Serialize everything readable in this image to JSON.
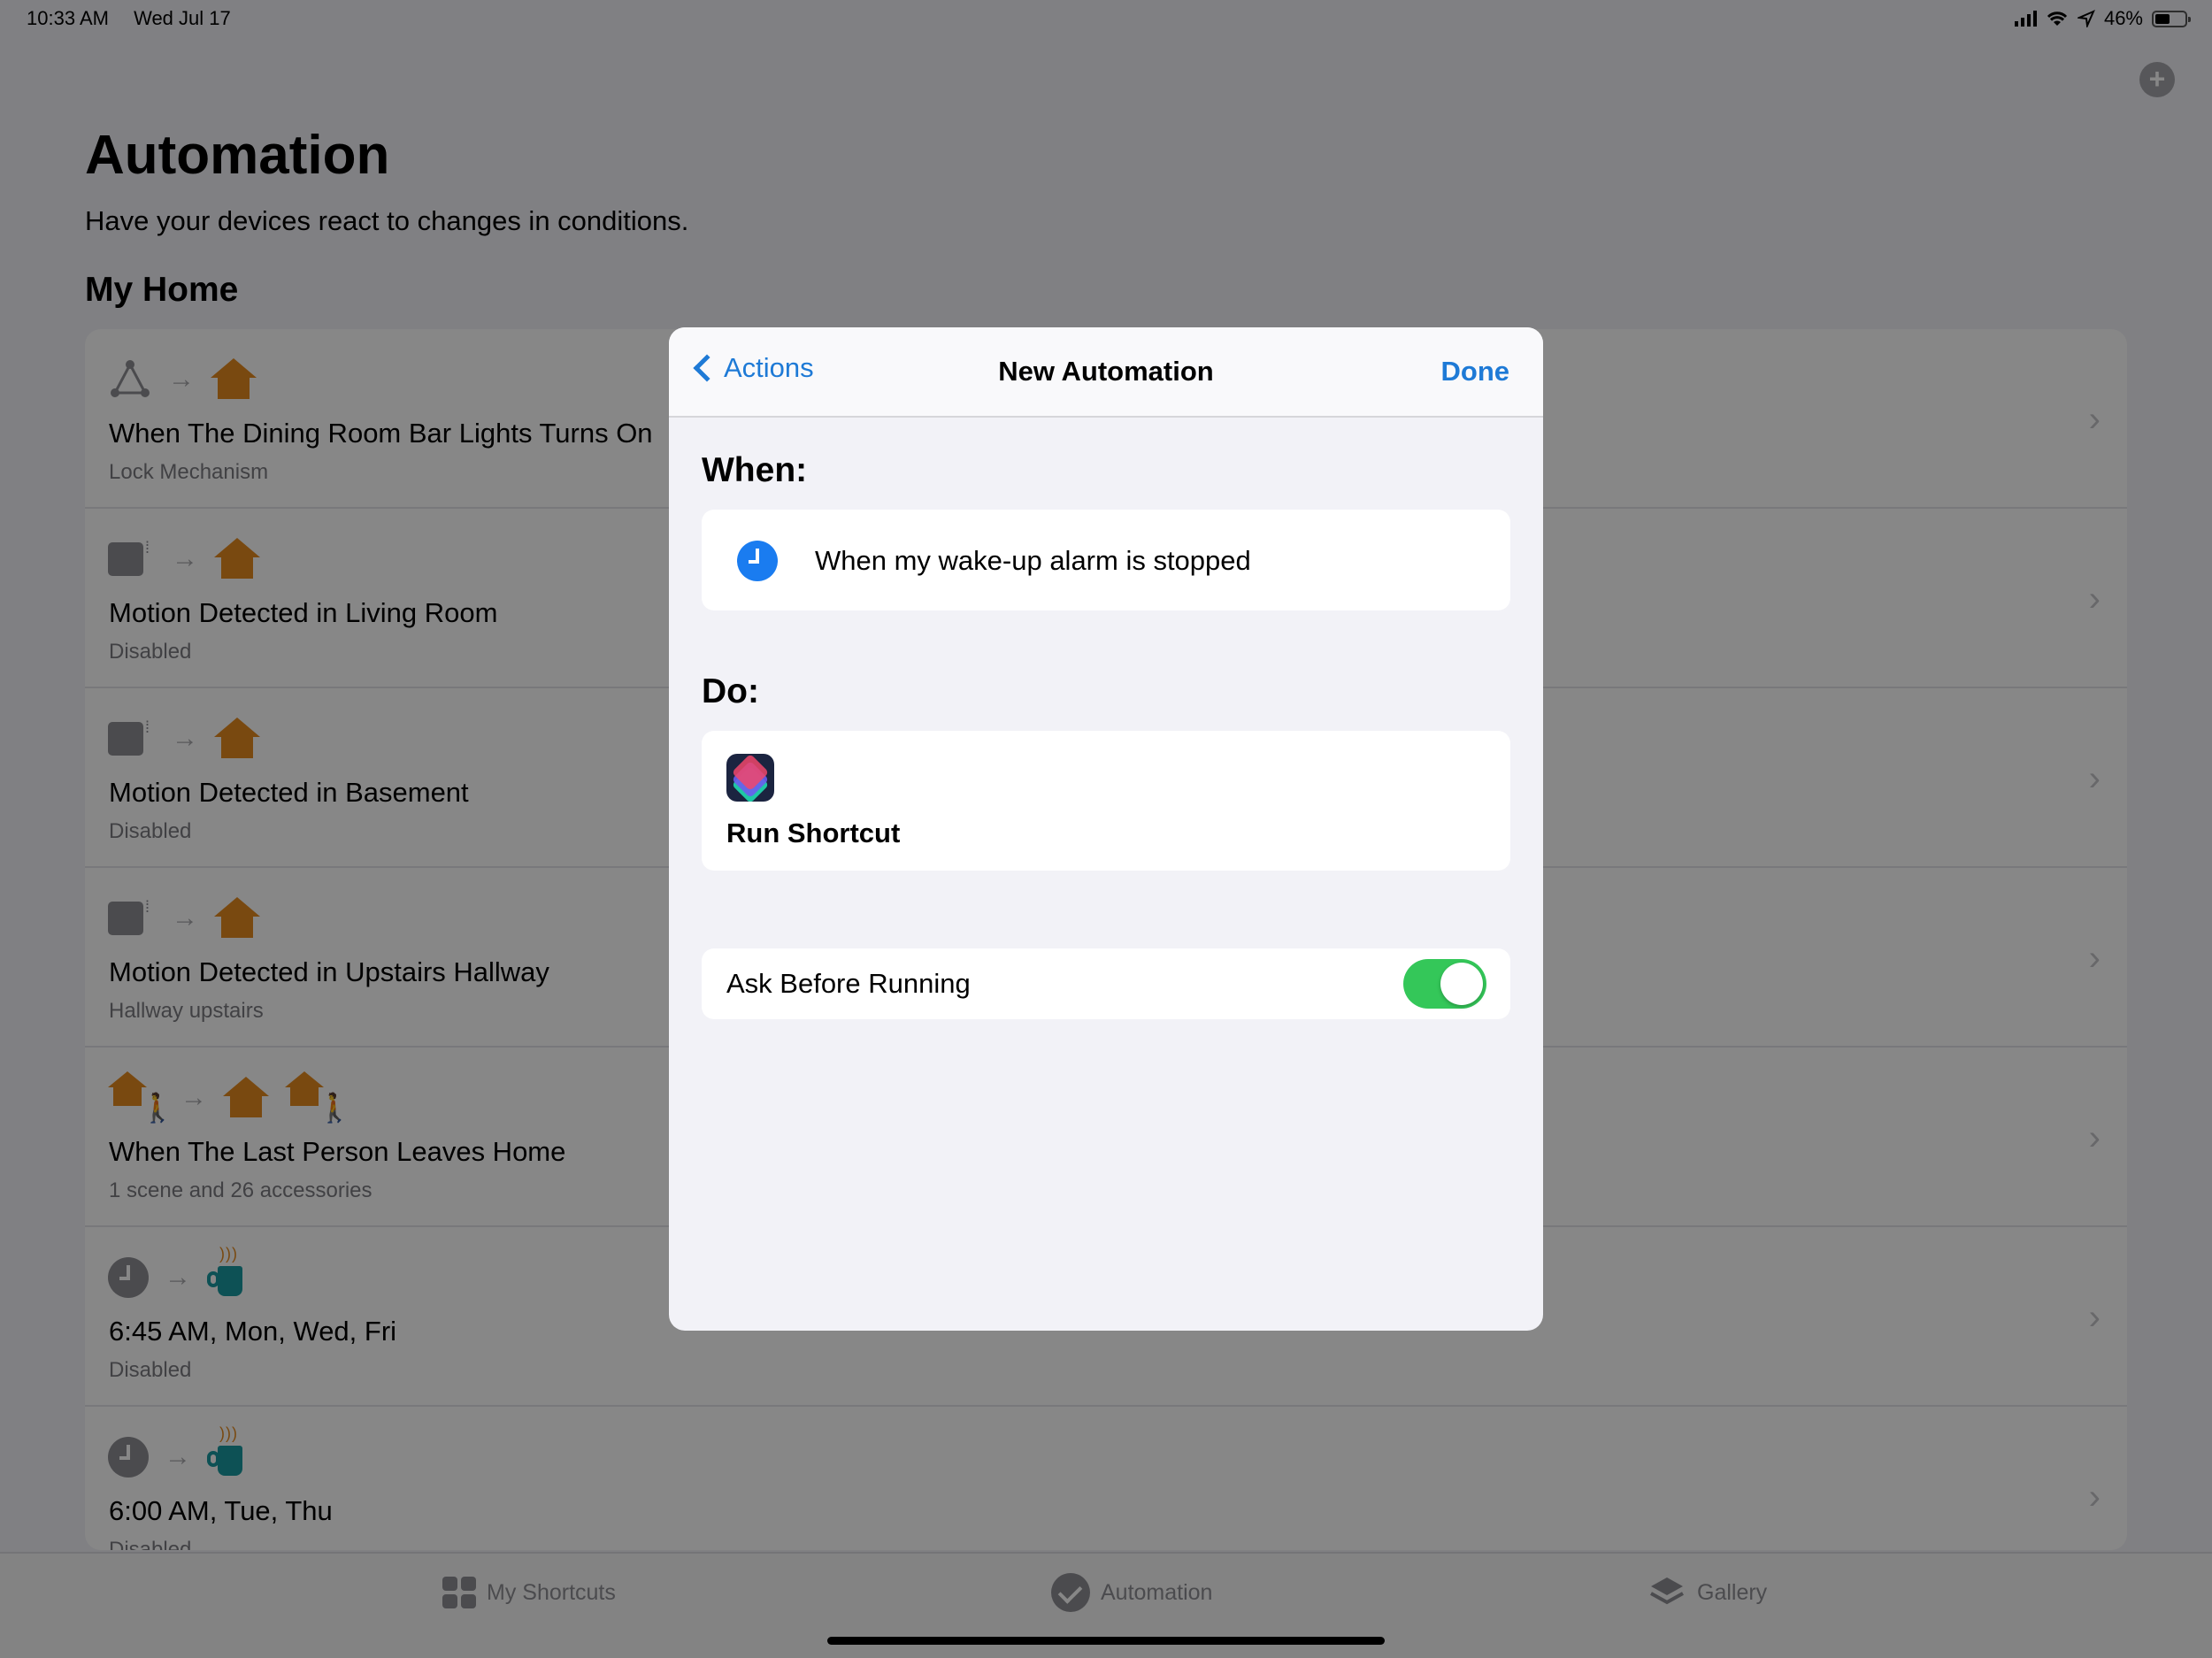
{
  "status_bar": {
    "time": "10:33 AM",
    "date": "Wed Jul 17",
    "battery": "46%"
  },
  "page": {
    "title": "Automation",
    "subtitle": "Have your devices react to changes in conditions.",
    "section": "My Home"
  },
  "automations": [
    {
      "title": "When The Dining Room Bar Lights Turns On",
      "subtitle": "Lock Mechanism",
      "icons": [
        "network-icon",
        "arrow-icon",
        "home-icon"
      ]
    },
    {
      "title": "Motion Detected in Living Room",
      "subtitle": "Disabled",
      "icons": [
        "motion-sensor-icon",
        "arrow-icon",
        "home-icon"
      ]
    },
    {
      "title": "Motion Detected in Basement",
      "subtitle": "Disabled",
      "icons": [
        "motion-sensor-icon",
        "arrow-icon",
        "home-icon"
      ]
    },
    {
      "title": "Motion Detected in Upstairs Hallway",
      "subtitle": "Hallway upstairs",
      "icons": [
        "motion-sensor-icon",
        "arrow-icon",
        "home-icon"
      ]
    },
    {
      "title": "When The Last Person Leaves Home",
      "subtitle": "1 scene and 26 accessories",
      "icons": [
        "person-leaving-home-icon",
        "arrow-icon",
        "home-icon",
        "person-leaving-home-icon"
      ]
    },
    {
      "title": "6:45 AM, Mon, Wed, Fri",
      "subtitle": "Disabled",
      "icons": [
        "clock-icon",
        "arrow-icon",
        "coffee-mug-icon"
      ]
    },
    {
      "title": "6:00 AM, Tue, Thu",
      "subtitle": "Disabled",
      "icons": [
        "clock-icon",
        "arrow-icon",
        "coffee-mug-icon"
      ]
    }
  ],
  "tab_bar": {
    "tabs": [
      {
        "label": "My Shortcuts",
        "icon": "grid-icon"
      },
      {
        "label": "Automation",
        "icon": "checkmark-circle-icon"
      },
      {
        "label": "Gallery",
        "icon": "layers-icon"
      }
    ]
  },
  "modal": {
    "back_label": "Actions",
    "title": "New Automation",
    "done_label": "Done",
    "when_label": "When:",
    "when_text": "When my wake-up alarm is stopped",
    "do_label": "Do:",
    "do_action": "Run Shortcut",
    "ask_before_running_label": "Ask Before Running",
    "ask_before_running_on": true
  },
  "colors": {
    "accent": "#1e7ad6",
    "toggle_on": "#34c759",
    "home": "#e48a1f"
  }
}
